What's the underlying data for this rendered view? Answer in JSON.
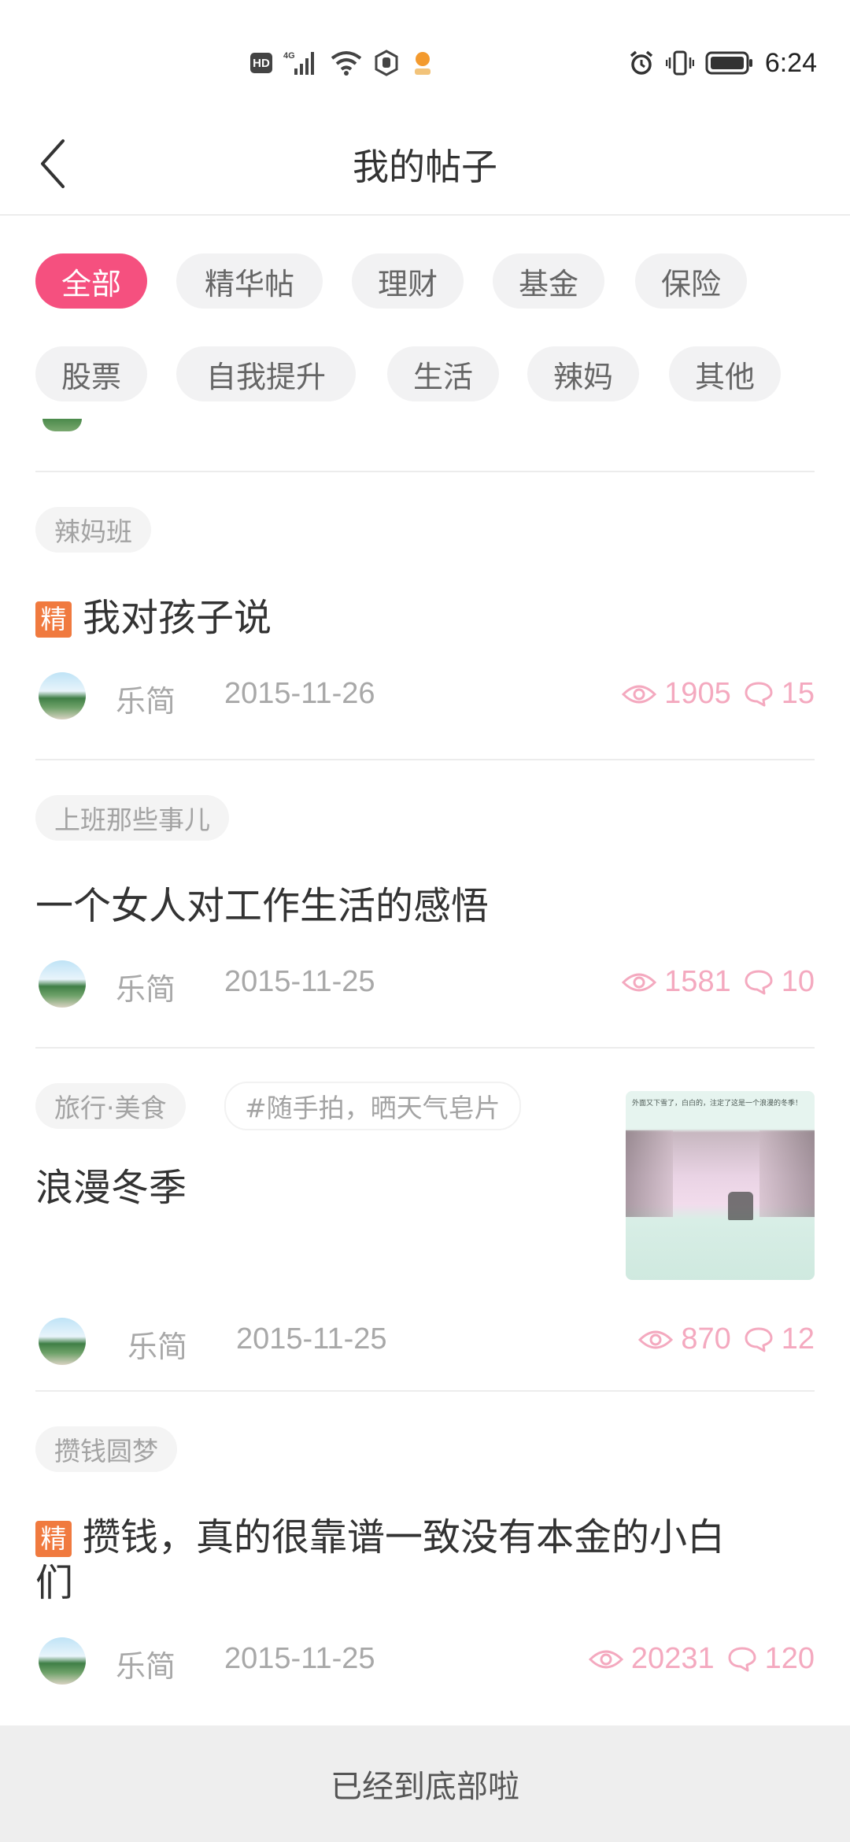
{
  "status_bar": {
    "left_icons": [
      "hd-icon",
      "4g-signal-icon",
      "wifi-icon",
      "hand-icon",
      "app-notification-icon"
    ],
    "right_icons": [
      "alarm-icon",
      "vibrate-icon",
      "battery-icon"
    ],
    "time": "6:24"
  },
  "header": {
    "title": "我的帖子"
  },
  "filters": {
    "row1": [
      "全部",
      "精华帖",
      "理财",
      "基金",
      "保险"
    ],
    "row2": [
      "股票",
      "自我提升",
      "生活",
      "辣妈",
      "其他"
    ],
    "active": "全部"
  },
  "posts": [
    {
      "tags": [
        "辣妈班"
      ],
      "featured": true,
      "featured_label": "精",
      "title": "我对孩子说",
      "author": "乐简",
      "date": "2015-11-26",
      "views": "1905",
      "comments": "15"
    },
    {
      "tags": [
        "上班那些事儿"
      ],
      "featured": false,
      "title": "一个女人对工作生活的感悟",
      "author": "乐简",
      "date": "2015-11-25",
      "views": "1581",
      "comments": "10"
    },
    {
      "tags": [
        "旅行·美食",
        "#随手拍，晒天气皂片"
      ],
      "featured": false,
      "title": "浪漫冬季",
      "author": "乐简",
      "date": "2015-11-25",
      "views": "870",
      "comments": "12",
      "thumbnail_text": "外面又下雪了，白白的，注定了这是一个浪漫的冬季！"
    },
    {
      "tags": [
        "攒钱圆梦"
      ],
      "featured": true,
      "featured_label": "精",
      "title_line1": "攒钱，真的很靠谱一致没有本金的小白",
      "title_line2": "们",
      "author": "乐简",
      "date": "2015-11-25",
      "views": "20231",
      "comments": "120"
    }
  ],
  "footer": {
    "text": "已经到底部啦"
  },
  "colors": {
    "accent": "#f5507f",
    "featured": "#f07a3f",
    "stats": "#f4a9bf"
  }
}
